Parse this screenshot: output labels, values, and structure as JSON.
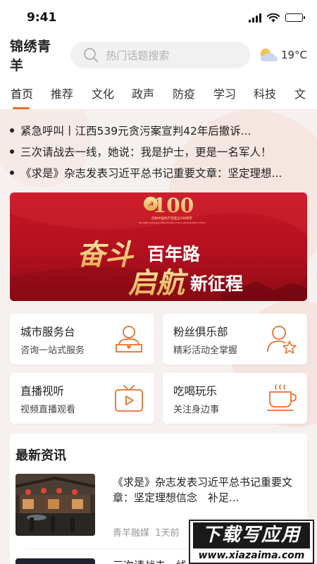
{
  "status_bar": {
    "time": "9:41"
  },
  "header": {
    "logo": "锦绣青羊",
    "search_placeholder": "热门话题搜索",
    "weather": {
      "icon": "partly-cloudy-icon",
      "temp": "19°C"
    }
  },
  "tabs": [
    "首页",
    "推荐",
    "文化",
    "政声",
    "防疫",
    "学习",
    "科技",
    "文"
  ],
  "active_tab": 0,
  "headlines": [
    "紧急呼叫丨江西539元贪污案宣判42年后撤诉...",
    "三次请战去一线，她说：我是护士，更是一名军人！",
    "《求是》杂志发表习近平总书记重要文章：坚定理想..."
  ],
  "banner": {
    "badge_number": "100",
    "badge_caption_cn": "庆祝中国共产党成立100周年",
    "badge_caption_en": "The 100th Anniversary of the Founding of The Communist Party of China",
    "line1_big": "奋斗",
    "line1_small": "百年路",
    "line2_big": "启航",
    "line2_small": "新征程"
  },
  "services": [
    {
      "title": "城市服务台",
      "subtitle": "咨询一站式服务",
      "icon": "service-desk-icon"
    },
    {
      "title": "粉丝俱乐部",
      "subtitle": "精彩活动全掌握",
      "icon": "fan-club-icon"
    },
    {
      "title": "直播视听",
      "subtitle": "视频直播观看",
      "icon": "tv-play-icon"
    },
    {
      "title": "吃喝玩乐",
      "subtitle": "关注身边事",
      "icon": "coffee-cup-icon"
    }
  ],
  "news": {
    "section_title": "最新资讯",
    "items": [
      {
        "title": "《求是》杂志发表习近平总书记重要文章：坚定理想信念　补足...",
        "source": "青羊融媒",
        "time": "1天前"
      },
      {
        "title": "三次请战去一线，她说：我是护士"
      }
    ]
  },
  "watermark": {
    "text": "下载写应用",
    "url": "www.xiazaima.com"
  },
  "colors": {
    "accent": "#e8702a",
    "banner_red": "#c8172a",
    "gold": "#f2c25a"
  }
}
